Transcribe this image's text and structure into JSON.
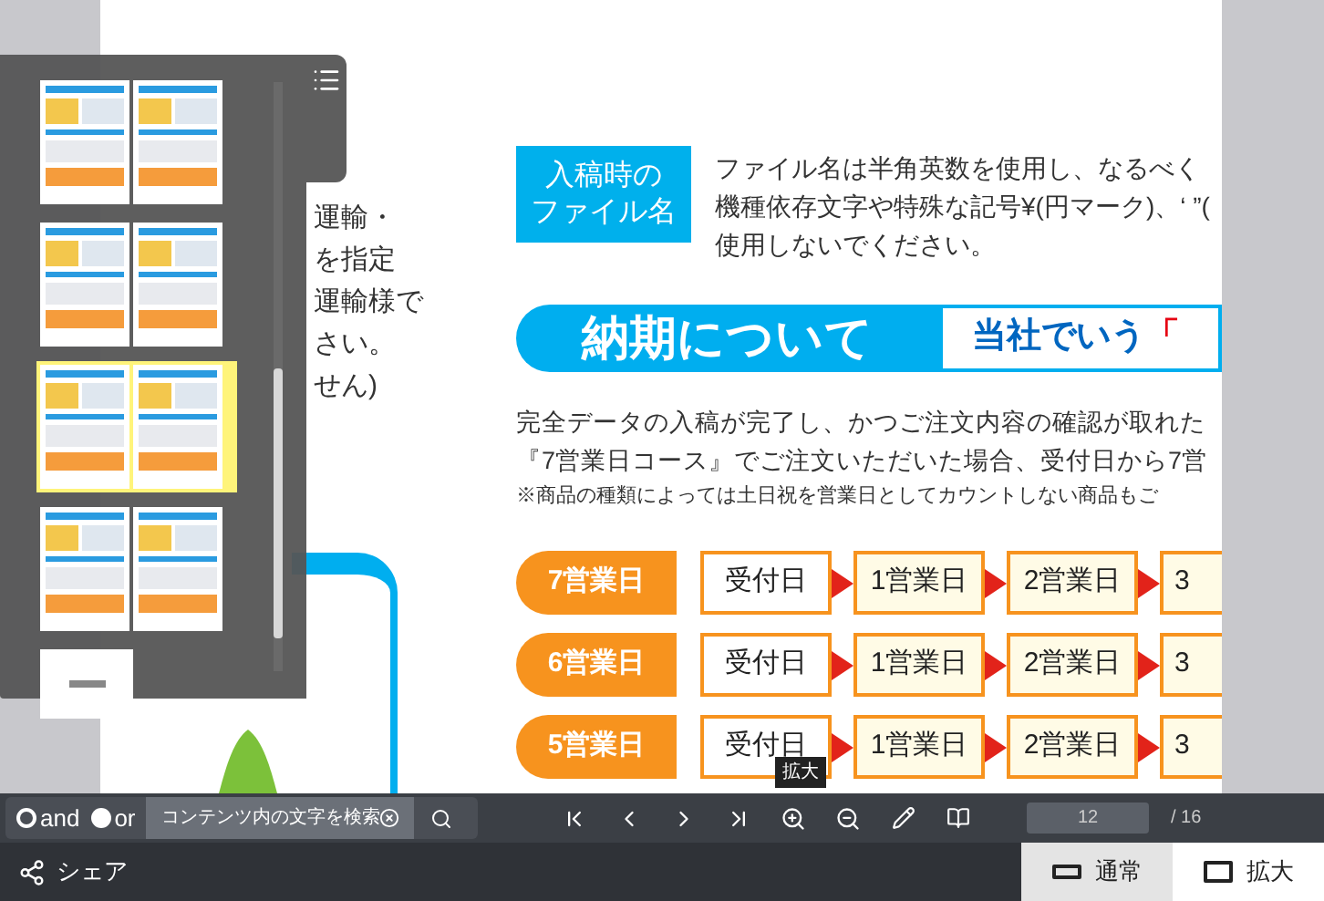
{
  "thumbnail_panel": {
    "items": [
      {
        "kind": "spread",
        "selected": false
      },
      {
        "kind": "spread",
        "selected": false
      },
      {
        "kind": "spread",
        "selected": true
      },
      {
        "kind": "spread",
        "selected": false
      },
      {
        "kind": "single",
        "selected": false
      }
    ]
  },
  "background_text": [
    "運輸・",
    "を指定",
    "運輸様で",
    "さい。",
    "せん)"
  ],
  "file_name_section": {
    "label_lines": [
      "入稿時の",
      "ファイル名"
    ],
    "lines": [
      "ファイル名は半角英数を使用し、なるべく",
      "機種依存文字や特殊な記号¥(円マーク)、‘ ”(",
      "使用しないでください。"
    ]
  },
  "delivery_banner": {
    "title": "納期について",
    "subtitle": "当社でいう",
    "subtitle_mark": "「"
  },
  "intro": {
    "lines": [
      "完全データの入稿が完了し、かつご注文内容の確認が取れた",
      "『7営業日コース』でご注文いただいた場合、受付日から7営"
    ],
    "note": "※商品の種類によっては土日祝を営業日としてカウントしない商品もご"
  },
  "schedule_rows": [
    {
      "label": "7営業日",
      "steps": [
        {
          "label": "受付日",
          "kind": "start"
        },
        {
          "label": "1営業日",
          "kind": "day"
        },
        {
          "label": "2営業日",
          "kind": "day"
        },
        {
          "label": "3",
          "kind": "partial"
        }
      ]
    },
    {
      "label": "6営業日",
      "steps": [
        {
          "label": "受付日",
          "kind": "start"
        },
        {
          "label": "1営業日",
          "kind": "day"
        },
        {
          "label": "2営業日",
          "kind": "day"
        },
        {
          "label": "3",
          "kind": "partial"
        }
      ]
    },
    {
      "label": "5営業日",
      "steps": [
        {
          "label": "受付日",
          "kind": "start"
        },
        {
          "label": "1営業日",
          "kind": "day"
        },
        {
          "label": "2営業日",
          "kind": "day"
        },
        {
          "label": "3",
          "kind": "partial"
        }
      ]
    }
  ],
  "tooltip": "拡大",
  "toolbar": {
    "search_modes": [
      {
        "label": "and",
        "selected": true
      },
      {
        "label": "or",
        "selected": false
      }
    ],
    "search": {
      "placeholder": "コンテンツ内の文字を検索"
    },
    "page": {
      "value": "12",
      "total": "/ 16"
    }
  },
  "bottom_bar": {
    "share": "シェア",
    "view_modes": [
      {
        "label": "通常",
        "selected": true
      },
      {
        "label": "拡大",
        "selected": false
      }
    ]
  }
}
